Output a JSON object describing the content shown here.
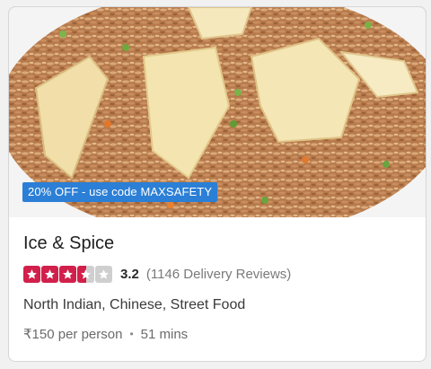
{
  "offer": {
    "text": "20% OFF - use code MAXSAFETY"
  },
  "restaurant": {
    "name": "Ice & Spice",
    "rating": 3.2,
    "rating_display": "3.2",
    "reviews_text": "(1146 Delivery Reviews)",
    "stars_filled": 3.5,
    "stars_total": 5,
    "cuisines": "North Indian, Chinese, Street Food",
    "price": "₹150 per person",
    "separator": "•",
    "delivery_time": "51 mins"
  },
  "colors": {
    "star_active": "#d1204b",
    "star_inactive": "#cfcfcf",
    "badge": "#2b7fd6"
  },
  "icons": {
    "image": "fried-rice-photo",
    "star": "star-icon"
  }
}
